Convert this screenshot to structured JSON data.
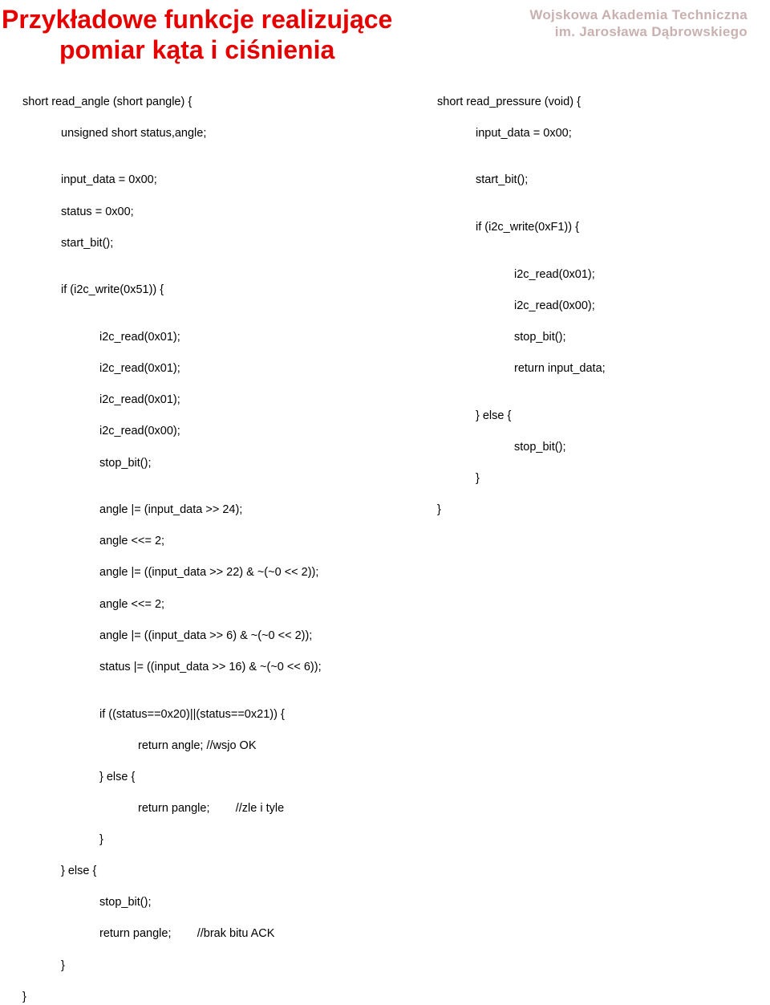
{
  "watermark": {
    "line1": "Wojskowa Akademia Techniczna",
    "line2": "im. Jarosława Dąbrowskiego"
  },
  "title": {
    "line1": "Przykładowe funkcje realizujące",
    "line2": "pomiar kąta i ciśnienia"
  },
  "left": {
    "l01": "short read_angle (short pangle) {",
    "l02": "unsigned short status,angle;",
    "l03": "input_data = 0x00;",
    "l04": "status = 0x00;",
    "l05": "start_bit();",
    "l06": "if (i2c_write(0x51)) {",
    "l07": "i2c_read(0x01);",
    "l08": "i2c_read(0x01);",
    "l09": "i2c_read(0x01);",
    "l10": "i2c_read(0x00);",
    "l11": "stop_bit();",
    "l12": "angle |= (input_data >> 24);",
    "l13": "angle <<= 2;",
    "l14": "angle |= ((input_data >> 22) & ~(~0 << 2));",
    "l15": "angle <<= 2;",
    "l16": "angle |= ((input_data >> 6) & ~(~0 << 2));",
    "l17": "status |= ((input_data >> 16) & ~(~0 << 6));",
    "l18": "if ((status==0x20)||(status==0x21)) {",
    "l19": "return angle; //wsjo OK",
    "l20": "} else {",
    "l21": "return pangle;        //zle i tyle",
    "l22": "}",
    "l23": "} else {",
    "l24": "stop_bit();",
    "l25": "return pangle;        //brak bitu ACK",
    "l26": "}",
    "l27": "}"
  },
  "right": {
    "r01": "short read_pressure (void) {",
    "r02": "input_data = 0x00;",
    "r03": "start_bit();",
    "r04": "if (i2c_write(0xF1)) {",
    "r05": "i2c_read(0x01);",
    "r06": "i2c_read(0x00);",
    "r07": "stop_bit();",
    "r08": "return input_data;",
    "r09": "} else {",
    "r10": "stop_bit();",
    "r11": "}",
    "r12": "}"
  }
}
